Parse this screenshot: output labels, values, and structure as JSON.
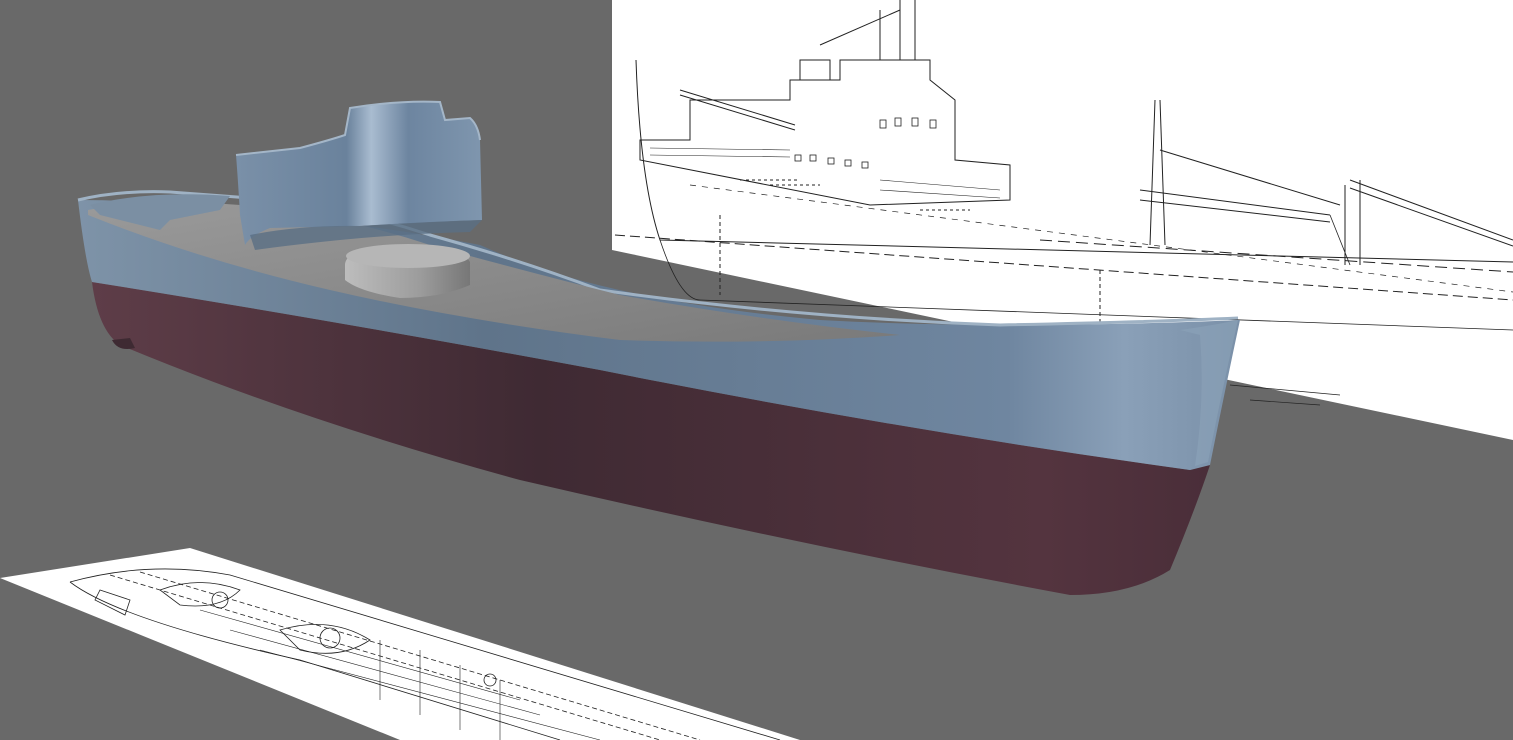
{
  "viewport": {
    "background_color": "#696969",
    "view": "3d-perspective"
  },
  "scene": {
    "model": {
      "subject": "cargo-ship-hull",
      "hull_upper_color": "#6d8297",
      "hull_lower_color": "#4a2f3a",
      "deck_color": "#8a8a8a",
      "superstructure_color": "#6d85a0"
    },
    "reference_images": [
      {
        "name": "side-elevation-blueprint",
        "plane": "vertical",
        "background": "#ffffff",
        "ink": "#222222"
      },
      {
        "name": "deck-plan-blueprint",
        "plane": "ground",
        "background": "#ffffff",
        "ink": "#222222"
      }
    ]
  }
}
